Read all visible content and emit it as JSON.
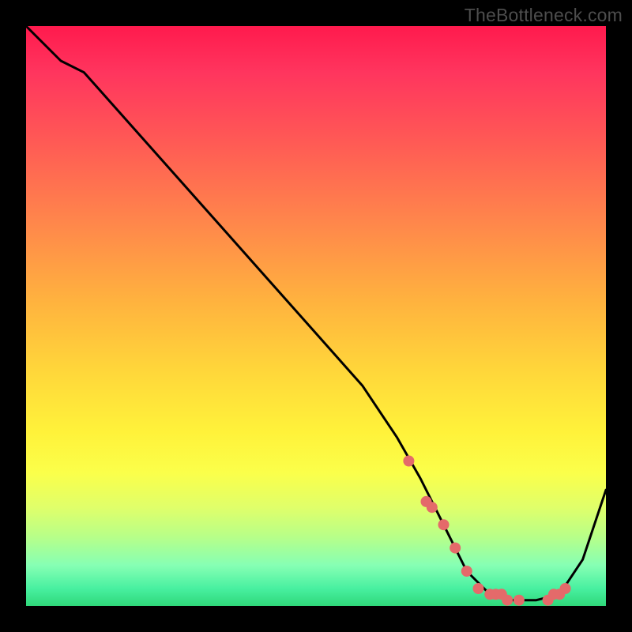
{
  "watermark": "TheBottleneck.com",
  "chart_data": {
    "type": "line",
    "title": "",
    "xlabel": "",
    "ylabel": "",
    "xlim": [
      0,
      100
    ],
    "ylim": [
      0,
      100
    ],
    "series": [
      {
        "name": "bottleneck-curve",
        "x": [
          0,
          6,
          10,
          18,
          26,
          34,
          42,
          50,
          58,
          64,
          68,
          72,
          76,
          80,
          84,
          88,
          92,
          96,
          100
        ],
        "values": [
          100,
          94,
          92,
          83,
          74,
          65,
          56,
          47,
          38,
          29,
          22,
          14,
          6,
          2,
          1,
          1,
          2,
          8,
          20
        ]
      }
    ],
    "markers": {
      "name": "highlight-dots",
      "color": "#e46a6a",
      "x": [
        66,
        69,
        70,
        72,
        74,
        76,
        78,
        80,
        81,
        82,
        83,
        85,
        90,
        91,
        92,
        93
      ],
      "values": [
        25,
        18,
        17,
        14,
        10,
        6,
        3,
        2,
        2,
        2,
        1,
        1,
        1,
        2,
        2,
        3
      ]
    }
  }
}
